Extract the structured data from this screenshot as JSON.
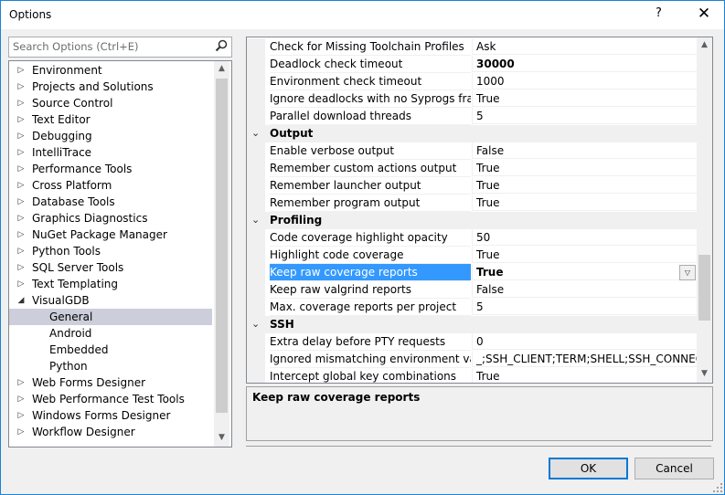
{
  "window": {
    "title": "Options",
    "help_label": "?",
    "close_label": "✕"
  },
  "search": {
    "placeholder": "Search Options (Ctrl+E)"
  },
  "tree": {
    "items": [
      {
        "label": "Environment",
        "expander": "▷"
      },
      {
        "label": "Projects and Solutions",
        "expander": "▷"
      },
      {
        "label": "Source Control",
        "expander": "▷"
      },
      {
        "label": "Text Editor",
        "expander": "▷"
      },
      {
        "label": "Debugging",
        "expander": "▷"
      },
      {
        "label": "IntelliTrace",
        "expander": "▷"
      },
      {
        "label": "Performance Tools",
        "expander": "▷"
      },
      {
        "label": "Cross Platform",
        "expander": "▷"
      },
      {
        "label": "Database Tools",
        "expander": "▷"
      },
      {
        "label": "Graphics Diagnostics",
        "expander": "▷"
      },
      {
        "label": "NuGet Package Manager",
        "expander": "▷"
      },
      {
        "label": "Python Tools",
        "expander": "▷"
      },
      {
        "label": "SQL Server Tools",
        "expander": "▷"
      },
      {
        "label": "Text Templating",
        "expander": "▷"
      },
      {
        "label": "VisualGDB",
        "expander": "◢"
      },
      {
        "label": "General",
        "expander": ""
      },
      {
        "label": "Android",
        "expander": ""
      },
      {
        "label": "Embedded",
        "expander": ""
      },
      {
        "label": "Python",
        "expander": ""
      },
      {
        "label": "Web Forms Designer",
        "expander": "▷"
      },
      {
        "label": "Web Performance Test Tools",
        "expander": "▷"
      },
      {
        "label": "Windows Forms Designer",
        "expander": "▷"
      },
      {
        "label": "Workflow Designer",
        "expander": "▷"
      }
    ]
  },
  "grid": {
    "rows": [
      {
        "kind": "prop",
        "name": "Check for Missing Toolchain Profiles",
        "value": "Ask"
      },
      {
        "kind": "prop",
        "name": "Deadlock check timeout",
        "value": "30000",
        "bold": true
      },
      {
        "kind": "prop",
        "name": "Environment check timeout",
        "value": "1000"
      },
      {
        "kind": "prop",
        "name": "Ignore deadlocks with no Syprogs frames",
        "value": "True"
      },
      {
        "kind": "prop",
        "name": "Parallel download threads",
        "value": "5"
      },
      {
        "kind": "cat",
        "name": "Output",
        "chevron": "⌄"
      },
      {
        "kind": "prop",
        "name": "Enable verbose output",
        "value": "False"
      },
      {
        "kind": "prop",
        "name": "Remember custom actions output",
        "value": "True"
      },
      {
        "kind": "prop",
        "name": "Remember launcher output",
        "value": "True"
      },
      {
        "kind": "prop",
        "name": "Remember program output",
        "value": "True"
      },
      {
        "kind": "cat",
        "name": "Profiling",
        "chevron": "⌄"
      },
      {
        "kind": "prop",
        "name": "Code coverage highlight opacity",
        "value": "50"
      },
      {
        "kind": "prop",
        "name": "Highlight code coverage",
        "value": "True"
      },
      {
        "kind": "prop",
        "name": "Keep raw coverage reports",
        "value": "True",
        "selected": true
      },
      {
        "kind": "prop",
        "name": "Keep raw valgrind reports",
        "value": "False"
      },
      {
        "kind": "prop",
        "name": "Max. coverage reports per project",
        "value": "5"
      },
      {
        "kind": "cat",
        "name": "SSH",
        "chevron": "⌄"
      },
      {
        "kind": "prop",
        "name": "Extra delay before PTY requests",
        "value": "0"
      },
      {
        "kind": "prop",
        "name": "Ignored mismatching environment vars",
        "value": "_;SSH_CLIENT;TERM;SHELL;SSH_CONNECTION"
      },
      {
        "kind": "prop",
        "name": "Intercept global key combinations",
        "value": "True"
      }
    ]
  },
  "description": {
    "title": "Keep raw coverage reports"
  },
  "buttons": {
    "ok": "OK",
    "cancel": "Cancel"
  }
}
